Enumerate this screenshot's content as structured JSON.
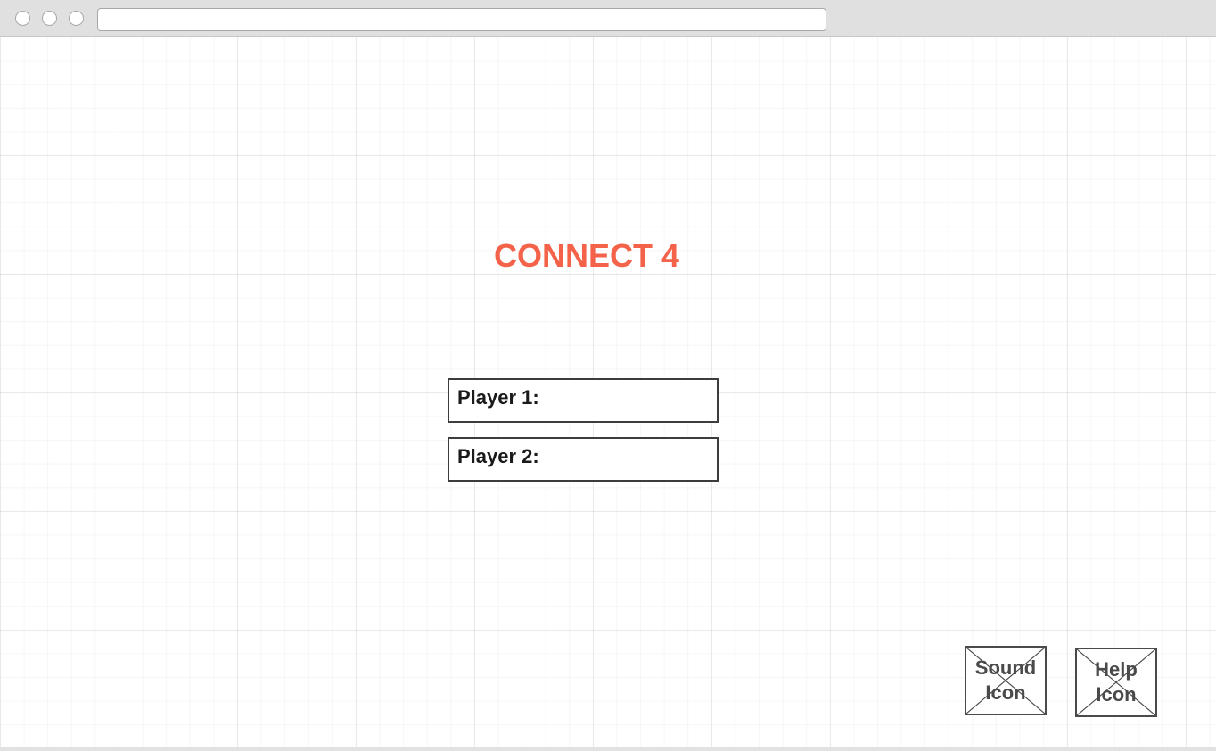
{
  "browser": {
    "address_value": "",
    "controls": [
      "close-button",
      "minimize-button",
      "zoom-button"
    ]
  },
  "game": {
    "title": "CONNECT 4",
    "title_color": "#f4624a",
    "player1_label": "Player 1:",
    "player2_label": "Player 2:"
  },
  "icons": {
    "sound_label": "Sound\nIcon",
    "help_label": "Help\nIcon"
  }
}
